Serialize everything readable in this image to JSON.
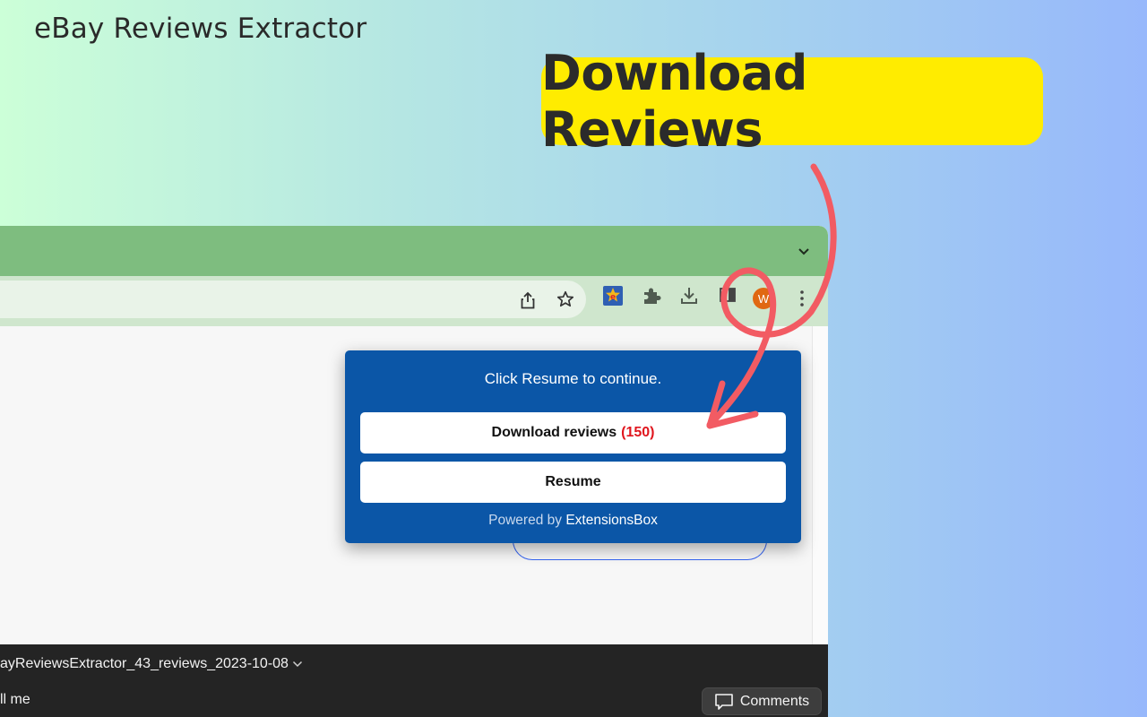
{
  "brand_title": "eBay Reviews Extractor",
  "callout": {
    "text": "Download Reviews"
  },
  "popup": {
    "status": "Click Resume to continue.",
    "download_label": "Download reviews",
    "download_count": "(150)",
    "resume_label": "Resume",
    "powered_prefix": "Powered by",
    "powered_brand": "ExtensionsBox"
  },
  "toolbar": {
    "profile_initial": "W"
  },
  "downloads_bar": {
    "file_name": "ayReviewsExtractor_43_reviews_2023-10-08",
    "action_text": "ll me",
    "comments_label": "Comments"
  },
  "colors": {
    "callout_bg": "#ffec00",
    "popup_bg": "#0b56a7",
    "count_red": "#e0161e",
    "arrow": "#f25b63",
    "tab_strip": "#7ebd7f"
  }
}
